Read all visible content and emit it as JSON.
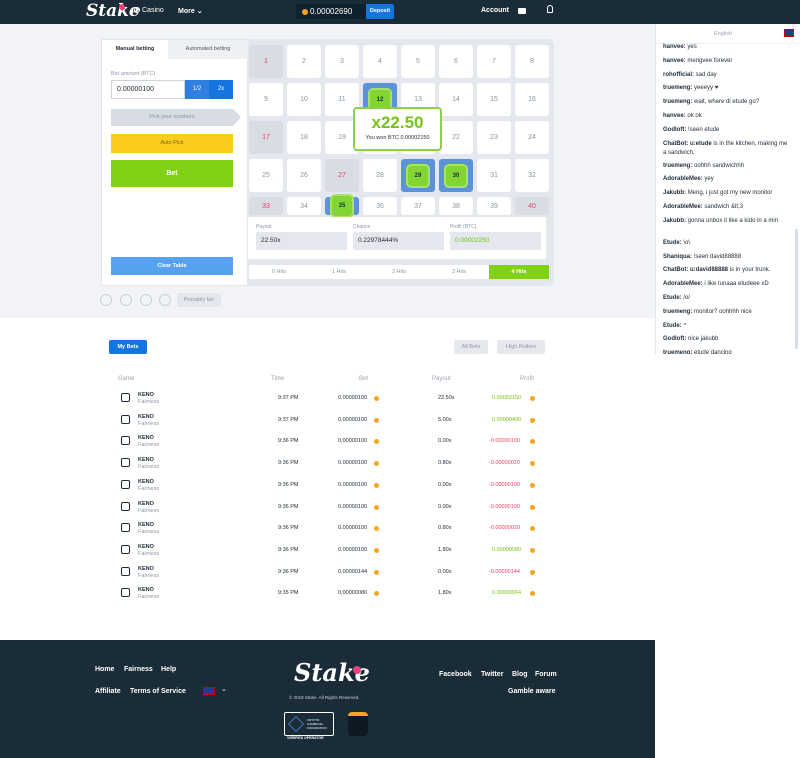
{
  "topbar": {
    "logo": "Stake",
    "casino": "Casino",
    "more": "More",
    "balance": "0.00002690",
    "deposit": "Deposit",
    "account": "Account"
  },
  "game": {
    "tab_manual": "Manual betting",
    "tab_auto": "Automated betting",
    "bet_amount_label": "Bet amount (BTC)",
    "bet_amount": "0.00000100",
    "half": "1/2",
    "double": "2x",
    "pick_label": "Pick your numbers",
    "auto_pick": "Auto Pick",
    "bet": "Bet",
    "clear_table": "Clear Table",
    "provably_fair": "Provably fair",
    "tiles": [
      {
        "n": "1",
        "s": "picked"
      },
      {
        "n": "2",
        "s": ""
      },
      {
        "n": "3",
        "s": ""
      },
      {
        "n": "4",
        "s": ""
      },
      {
        "n": "5",
        "s": ""
      },
      {
        "n": "6",
        "s": ""
      },
      {
        "n": "7",
        "s": ""
      },
      {
        "n": "8",
        "s": ""
      },
      {
        "n": "9",
        "s": ""
      },
      {
        "n": "10",
        "s": ""
      },
      {
        "n": "11",
        "s": ""
      },
      {
        "n": "12",
        "s": "hit"
      },
      {
        "n": "13",
        "s": ""
      },
      {
        "n": "14",
        "s": ""
      },
      {
        "n": "15",
        "s": ""
      },
      {
        "n": "16",
        "s": ""
      },
      {
        "n": "17",
        "s": "picked"
      },
      {
        "n": "18",
        "s": ""
      },
      {
        "n": "19",
        "s": ""
      },
      {
        "n": "20",
        "s": ""
      },
      {
        "n": "21",
        "s": ""
      },
      {
        "n": "22",
        "s": ""
      },
      {
        "n": "23",
        "s": ""
      },
      {
        "n": "24",
        "s": ""
      },
      {
        "n": "25",
        "s": ""
      },
      {
        "n": "26",
        "s": ""
      },
      {
        "n": "27",
        "s": "picked"
      },
      {
        "n": "28",
        "s": ""
      },
      {
        "n": "29",
        "s": "hit"
      },
      {
        "n": "30",
        "s": "hit"
      },
      {
        "n": "31",
        "s": ""
      },
      {
        "n": "32",
        "s": ""
      },
      {
        "n": "33",
        "s": "picked"
      },
      {
        "n": "34",
        "s": ""
      },
      {
        "n": "35",
        "s": "hit"
      },
      {
        "n": "36",
        "s": ""
      },
      {
        "n": "37",
        "s": ""
      },
      {
        "n": "38",
        "s": ""
      },
      {
        "n": "39",
        "s": ""
      },
      {
        "n": "40",
        "s": "picked"
      }
    ],
    "win_multiplier": "x22.50",
    "win_text": "You won BTC 0.00002150",
    "payout_label": "Payout",
    "payout": "22.50x",
    "chance_label": "Chance",
    "chance": "0.22978444%",
    "profit_label": "Profit (BTC)",
    "profit": "0.00002250",
    "hits": [
      "0 Hits",
      "1 Hits",
      "2 Hits",
      "3 Hits",
      "4 Hits"
    ],
    "active_hits": 4
  },
  "chat": {
    "language": "English",
    "messages": [
      {
        "user": "hanvee:",
        "text": "yes"
      },
      {
        "user": "hanvee:",
        "text": "mengvee forever"
      },
      {
        "user": "rohofficial:",
        "text": "sad day"
      },
      {
        "user": "truemeng:",
        "text": "yeeeyy ♥"
      },
      {
        "user": "truemeng:",
        "text": "wait, where di etude go?"
      },
      {
        "user": "hanvee:",
        "text": "ok ok"
      },
      {
        "user": "Godloft:",
        "text": "!seen etude"
      },
      {
        "user": "ChatBot: u:etude",
        "text": "is in the kitchen, making me a sandwich."
      },
      {
        "user": "truemeng:",
        "text": "oohhh sandwichhh"
      },
      {
        "user": "AdorableMee:",
        "text": "yey"
      },
      {
        "user": "Jakubb:",
        "text": "Meng, i just got my new monitor"
      },
      {
        "user": "AdorableMee:",
        "text": "sandwich &lt;3"
      },
      {
        "user": "Jakubb:",
        "text": "gonna unbox it like a kido in a min"
      },
      {
        "user": "Etude:",
        "text": "\\o\\"
      },
      {
        "user": "Shaniqua:",
        "text": "!seen david88888"
      },
      {
        "user": "ChatBot: u:david88888",
        "text": "is in your trunk."
      },
      {
        "user": "AdorableMee:",
        "text": "i like tunaaa etudeee xD"
      },
      {
        "user": "Etude:",
        "text": "/o/"
      },
      {
        "user": "truemeng:",
        "text": "monitor? oohhhh nice"
      },
      {
        "user": "Etude:",
        "text": "^"
      },
      {
        "user": "Godloft:",
        "text": "nice jakubb"
      },
      {
        "user": "truemeng:",
        "text": "etude dancing"
      }
    ]
  },
  "bets": {
    "my_bets": "My Bets",
    "all_bets": "All Bets",
    "high_rollers": "High Rollers",
    "headers": [
      "Game",
      "Time",
      "Bet",
      "Payout",
      "Profit"
    ],
    "rows": [
      {
        "game": "KENO",
        "sub": "Fairness",
        "time": "9:37 PM",
        "bet": "0.00000100",
        "payout": "22.50x",
        "profit": "0.00002150",
        "win": true
      },
      {
        "game": "KENO",
        "sub": "Fairness",
        "time": "9:37 PM",
        "bet": "0.00000100",
        "payout": "5.00x",
        "profit": "0.00000400",
        "win": true
      },
      {
        "game": "KENO",
        "sub": "Fairness",
        "time": "9:36 PM",
        "bet": "0.00000100",
        "payout": "0.00x",
        "profit": "-0.00000100",
        "win": false
      },
      {
        "game": "KENO",
        "sub": "Fairness",
        "time": "9:36 PM",
        "bet": "0.00000100",
        "payout": "0.80x",
        "profit": "-0.00000020",
        "win": false
      },
      {
        "game": "KENO",
        "sub": "Fairness",
        "time": "9:36 PM",
        "bet": "0.00000100",
        "payout": "0.00x",
        "profit": "-0.00000100",
        "win": false
      },
      {
        "game": "KENO",
        "sub": "Fairness",
        "time": "9:36 PM",
        "bet": "0.00000100",
        "payout": "0.00x",
        "profit": "-0.00000100",
        "win": false
      },
      {
        "game": "KENO",
        "sub": "Fairness",
        "time": "9:36 PM",
        "bet": "0.00000100",
        "payout": "0.80x",
        "profit": "-0.00000020",
        "win": false
      },
      {
        "game": "KENO",
        "sub": "Fairness",
        "time": "9:36 PM",
        "bet": "0.00000100",
        "payout": "1.80x",
        "profit": "0.00000080",
        "win": true
      },
      {
        "game": "KENO",
        "sub": "Fairness",
        "time": "9:36 PM",
        "bet": "0.00000144",
        "payout": "0.00x",
        "profit": "-0.00000144",
        "win": false
      },
      {
        "game": "KENO",
        "sub": "Fairness",
        "time": "9:35 PM",
        "bet": "0.00000080",
        "payout": "1.80x",
        "profit": "0.00000064",
        "win": true
      }
    ]
  },
  "footer": {
    "home": "Home",
    "fairness": "Fairness",
    "help": "Help",
    "affiliate": "Affiliate",
    "terms": "Terms of Service",
    "logo": "Stake",
    "copyright": "© 2018 Stake. All Rights Reserved.",
    "badge_title": "CRYPTO GAMBLING FOUNDATION",
    "badge_sub": "VERIFIED OPERATOR",
    "facebook": "Facebook",
    "twitter": "Twitter",
    "blog": "Blog",
    "forum": "Forum",
    "gamble_aware": "Gamble aware"
  }
}
